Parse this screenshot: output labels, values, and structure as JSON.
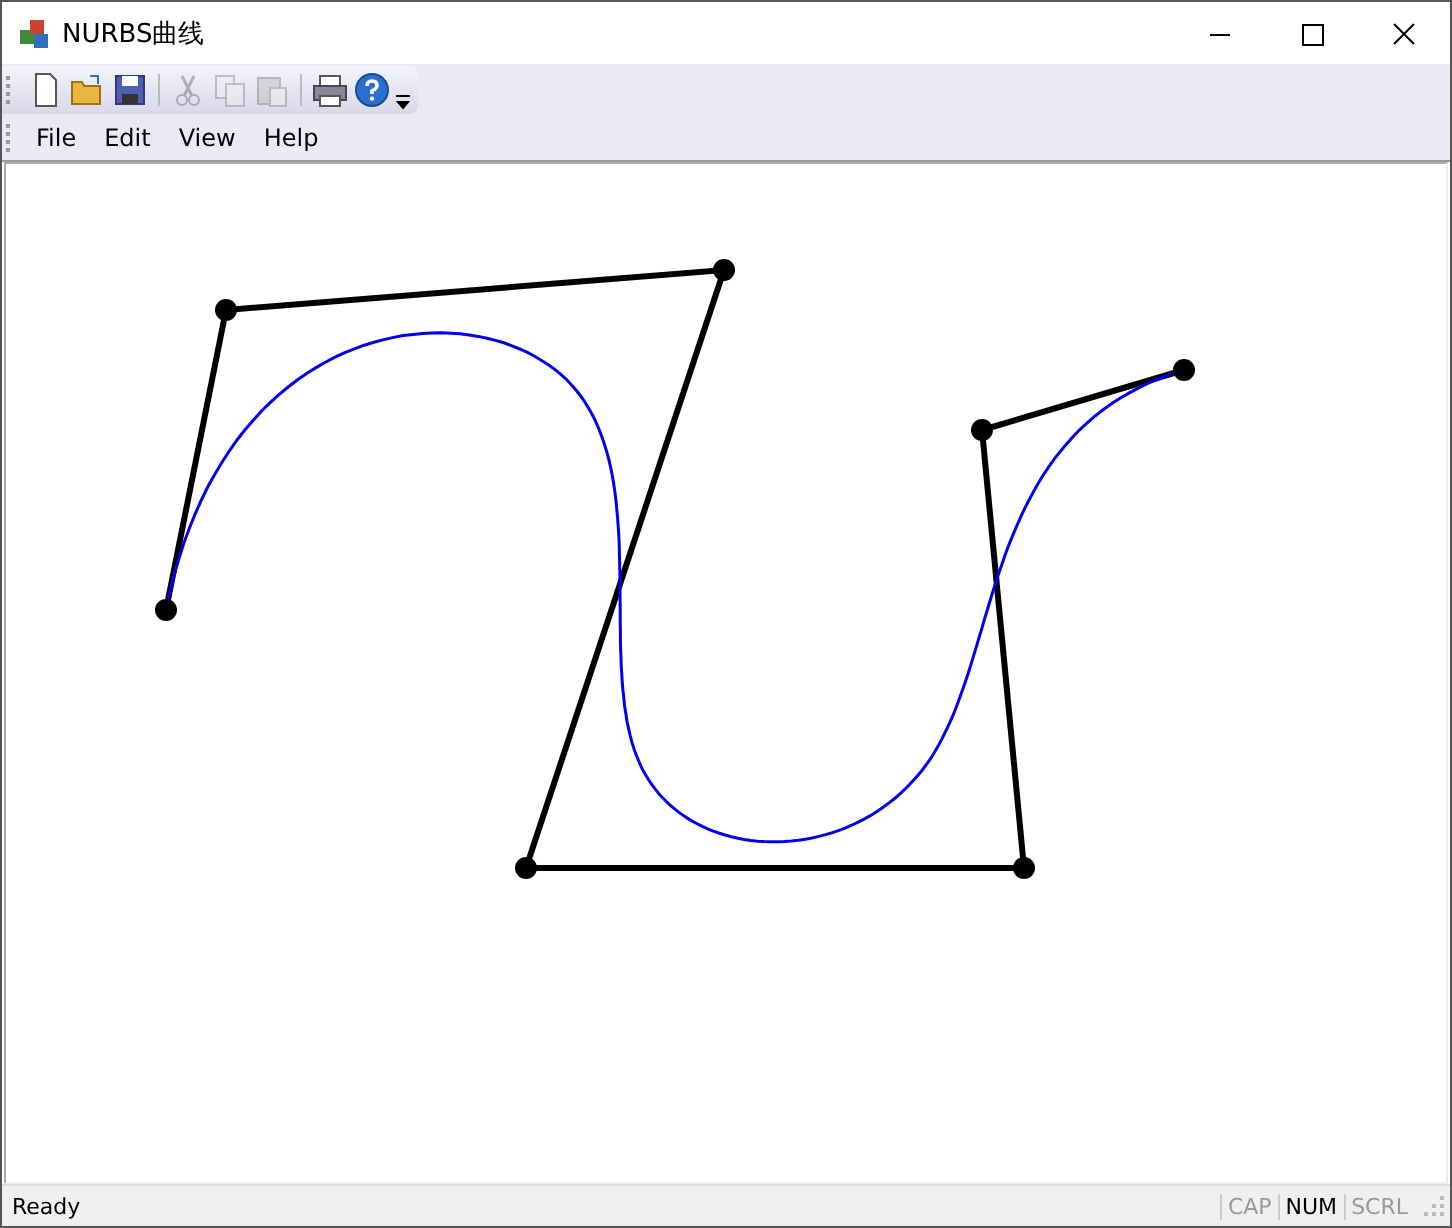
{
  "window": {
    "title": "NURBS曲线"
  },
  "toolbar": [
    {
      "kind": "new",
      "disabled": false
    },
    {
      "kind": "open",
      "disabled": false
    },
    {
      "kind": "save",
      "disabled": false
    },
    {
      "kind": "sep"
    },
    {
      "kind": "cut",
      "disabled": true
    },
    {
      "kind": "copy",
      "disabled": true
    },
    {
      "kind": "paste",
      "disabled": true
    },
    {
      "kind": "sep"
    },
    {
      "kind": "print",
      "disabled": false
    },
    {
      "kind": "help",
      "disabled": false
    }
  ],
  "menu": [
    "File",
    "Edit",
    "View",
    "Help"
  ],
  "status_bar": {
    "text": "Ready",
    "indicators": [
      {
        "label": "CAP",
        "on": false
      },
      {
        "label": "NUM",
        "on": true
      },
      {
        "label": "SCRL",
        "on": false
      }
    ]
  }
}
